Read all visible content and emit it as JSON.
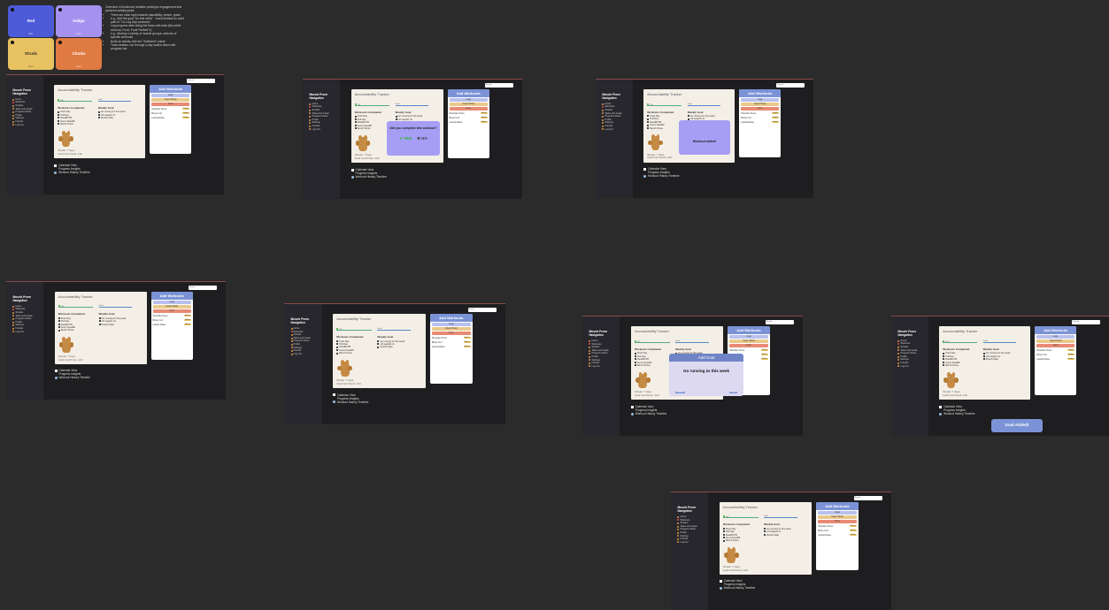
{
  "stickies": [
    {
      "label": "Red",
      "color": "#4d5bd9",
      "foot": "Bias"
    },
    {
      "label": "Indigo",
      "color": "#a591ee",
      "foot": "Dark"
    },
    {
      "label": "Struds",
      "color": "#e8c261",
      "foot": "Nmns"
    },
    {
      "label": "Clocks",
      "color": "#e07a43",
      "foot": "Nmns"
    }
  ],
  "notes": {
    "intro": "Overview: A functional, testable prototype engagement and personal activity goals.",
    "bullets": [
      "There are clear taps towards plausibility, viewer, goals",
      "e.g., Add the goal \"Go this week\" - Used dismiss on solid path of \"Go Log Day workouts\"",
      "Log progress after doing the flows with data (Bar while workout, Food, Food Peeked X)",
      "e.g., Moving a variety of muscle groups; selector of specific workouts",
      "Build an activity with the \"Sufficient\" points",
      "Track streaks: run through a day scaled down with progress bar"
    ]
  },
  "app": {
    "sidebar_title": "Muscle Prone Navigation",
    "sidebar_items": [
      "Home",
      "Workouts",
      "Streaks",
      "Tasks and Goals",
      "Progress Sheet",
      "Profile",
      "Settings",
      "Friends",
      "Log Out"
    ],
    "search_placeholder": "Search",
    "panel_title": "Accountability Tracker",
    "bar1": "100",
    "bar2": "Goals",
    "workouts_completed_title": "Workouts Completed",
    "workouts_completed": [
      "Push Day",
      "Pull Day",
      "Deadlift PR",
      "Sumo Deadlift",
      "Bench Press"
    ],
    "weekly_goal_title": "Weekly Goal",
    "weekly_goal_items": [
      "Go running 2x this week",
      "Lift weights 4x",
      "Stretch daily"
    ],
    "streak_line1": "Streak: 7 days",
    "streak_line2": "Gold Cat Points: 120",
    "add_workouts": "Add Workouts",
    "options": [
      "Legs",
      "Upper Body",
      "Core"
    ],
    "rows": [
      {
        "label": "Shoulder Press",
        "sub": "3 sets"
      },
      {
        "label": "Bicep Curl",
        "sub": "3 sets"
      },
      {
        "label": "Lateral Raise",
        "sub": "3 sets"
      }
    ],
    "select": "Select",
    "legend": [
      "Calendar View",
      "Progress Insights",
      "Workout History Timeline"
    ]
  },
  "modal_complete": {
    "title": "Did you complete this workout?",
    "yes": "YES",
    "no": "NO"
  },
  "modal_added": {
    "title": "Workout added!"
  },
  "goal_modal": {
    "title": "Add Goal",
    "text": "Go running 2x this week",
    "cancel": "Cancel",
    "save": "Save"
  },
  "toast": "Goal Added!"
}
